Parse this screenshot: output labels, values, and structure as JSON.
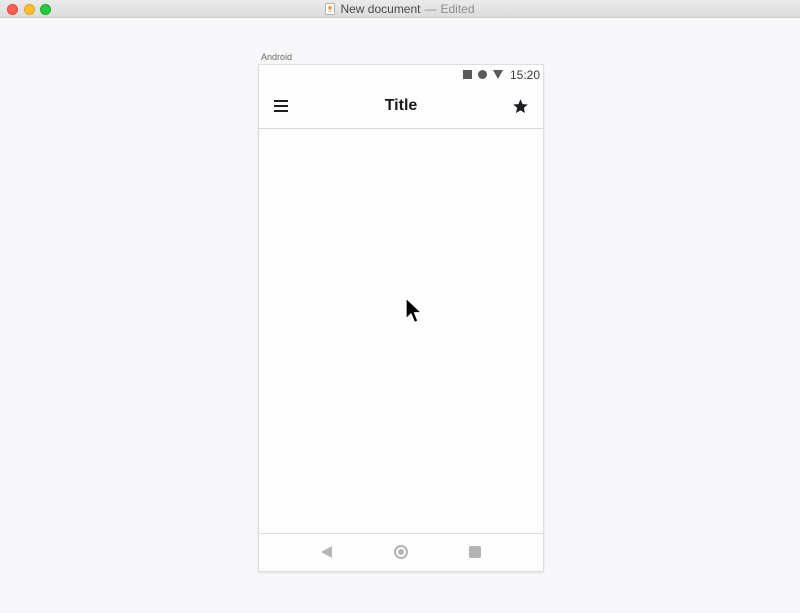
{
  "window": {
    "document_title": "New document",
    "separator": "—",
    "status": "Edited"
  },
  "artboard": {
    "label": "Android"
  },
  "device": {
    "status_bar": {
      "time": "15:20"
    },
    "app_bar": {
      "title": "Title",
      "left_icon": "menu-icon",
      "right_icon": "star-icon"
    },
    "nav_bar": {
      "icons": [
        "back-icon",
        "home-icon",
        "recents-icon"
      ]
    }
  },
  "colors": {
    "close": "#fd5f57",
    "minimize": "#febc2e",
    "maximize": "#28c840",
    "title_text": "#1b1b1b",
    "nav_icon": "#b4b4b4"
  }
}
